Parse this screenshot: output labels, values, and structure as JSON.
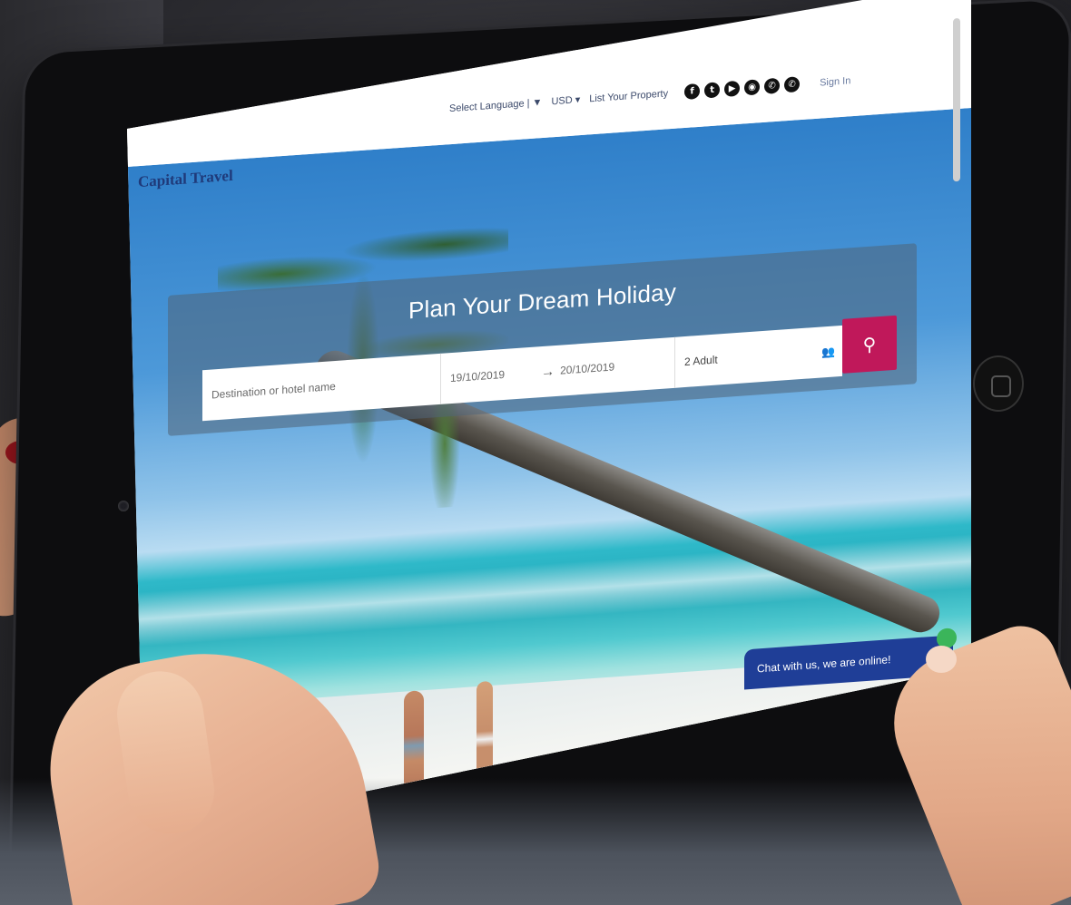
{
  "header": {
    "logo_text": "Capital Travel",
    "nav": {
      "language": "Select Language | ▼",
      "currency": "USD ▾",
      "list_property": "List Your Property",
      "sign_in": "Sign In"
    },
    "social_icons": [
      "facebook-icon",
      "twitter-icon",
      "youtube-icon",
      "instagram-icon",
      "viber-icon",
      "whatsapp-icon"
    ],
    "social_glyphs": [
      "f",
      "t",
      "▶",
      "◉",
      "✆",
      "✆"
    ]
  },
  "search": {
    "title": "Plan Your Dream Holiday",
    "destination_placeholder": "Destination or hotel name",
    "check_in": "19/10/2019",
    "check_out": "20/10/2019",
    "arrow": "→",
    "guests": "2 Adult",
    "search_icon": "⚲"
  },
  "chat": {
    "label": "Chat with us, we are online!"
  },
  "colors": {
    "brand": "#1f3a7a",
    "search_button": "#c0185a",
    "chat_bg": "#1f3e97"
  }
}
